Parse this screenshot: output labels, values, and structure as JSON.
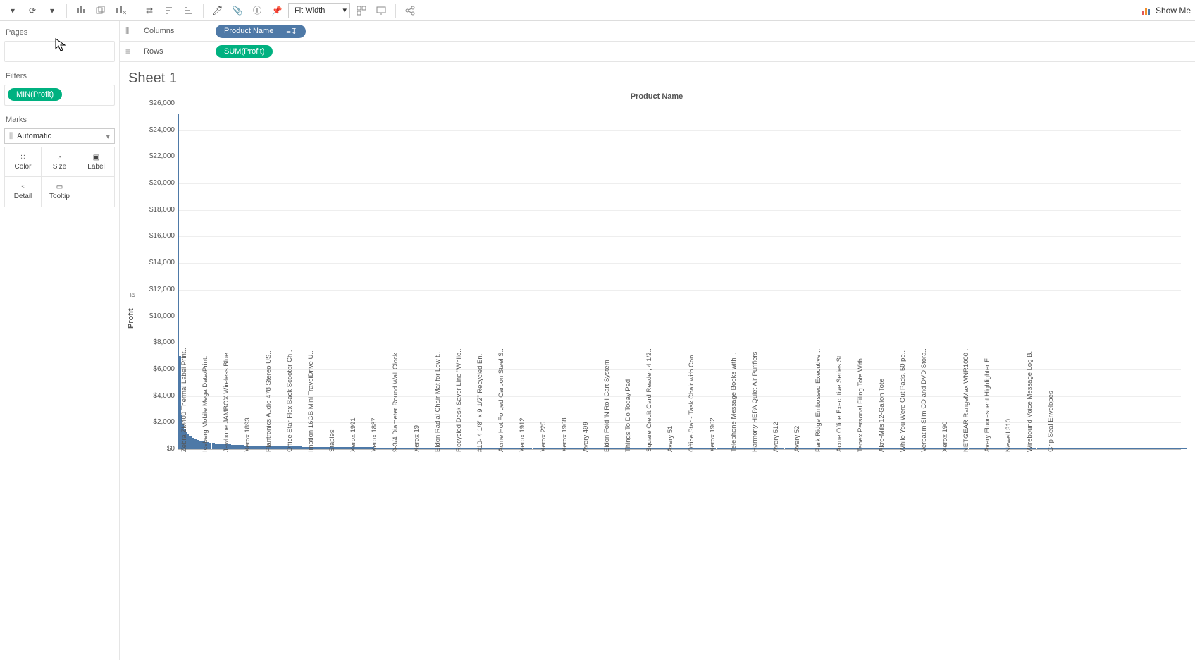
{
  "toolbar": {
    "fit_mode": "Fit Width",
    "showme": "Show Me"
  },
  "side": {
    "pages": "Pages",
    "filters": "Filters",
    "filter_pill": "MIN(Profit)",
    "marks": "Marks",
    "marks_type": "Automatic",
    "cells": {
      "color": "Color",
      "size": "Size",
      "label": "Label",
      "detail": "Detail",
      "tooltip": "Tooltip"
    }
  },
  "shelves": {
    "columns_label": "Columns",
    "rows_label": "Rows",
    "columns_pill": "Product Name",
    "rows_pill": "SUM(Profit)"
  },
  "sheet_title": "Sheet 1",
  "chart_data": {
    "type": "bar",
    "title": "Product Name",
    "ylabel": "Profit",
    "ylim": [
      0,
      26000
    ],
    "y_ticks": [
      "$0",
      "$2,000",
      "$4,000",
      "$6,000",
      "$8,000",
      "$10,000",
      "$12,000",
      "$14,000",
      "$16,000",
      "$18,000",
      "$20,000",
      "$22,000",
      "$24,000",
      "$26,000"
    ],
    "x_labels": [
      {
        "t": "Zebra ZM400 Thermal Label Print..",
        "p": 0
      },
      {
        "t": "Iceberg Mobile Mega Data/Print..",
        "p": 30
      },
      {
        "t": "Jawbone JAMBOX Wireless Blue..",
        "p": 60
      },
      {
        "t": "Xerox 1893",
        "p": 90
      },
      {
        "t": "Plantronics Audio 478 Stereo US..",
        "p": 120
      },
      {
        "t": "Office Star Flex Back Scooter Ch..",
        "p": 150
      },
      {
        "t": "Imation 16GB Mini TravelDrive U..",
        "p": 180
      },
      {
        "t": "Staples",
        "p": 210
      },
      {
        "t": "Xerox 1991",
        "p": 240
      },
      {
        "t": "Xerox 1887",
        "p": 270
      },
      {
        "t": "9-3/4 Diameter Round Wall Clock",
        "p": 300
      },
      {
        "t": "Xerox 19",
        "p": 330
      },
      {
        "t": "Eldon Radial Chair Mat for Low t..",
        "p": 360
      },
      {
        "t": "Recycled Desk Saver Line \"While..",
        "p": 390
      },
      {
        "t": "#10- 4 1/8\" x 9 1/2\" Recycled En..",
        "p": 420
      },
      {
        "t": "Acme Hot Forged Carbon Steel S..",
        "p": 450
      },
      {
        "t": "Xerox 1912",
        "p": 480
      },
      {
        "t": "Xerox 225",
        "p": 510
      },
      {
        "t": "Xerox 1968",
        "p": 540
      },
      {
        "t": "Avery 499",
        "p": 570
      },
      {
        "t": "Eldon Fold 'N Roll Cart System",
        "p": 600
      },
      {
        "t": "Things To Do Today Pad",
        "p": 630
      },
      {
        "t": "Square Credit Card Reader, 4 1/2..",
        "p": 660
      },
      {
        "t": "Avery 51",
        "p": 690
      },
      {
        "t": "Office Star - Task Chair with Con..",
        "p": 720
      },
      {
        "t": "Xerox 1962",
        "p": 750
      },
      {
        "t": "Telephone Message Books with ..",
        "p": 780
      },
      {
        "t": "Harmony HEPA Quiet Air Purifiers",
        "p": 810
      },
      {
        "t": "Avery 512",
        "p": 840
      },
      {
        "t": "Avery 52",
        "p": 870
      },
      {
        "t": "Park Ridge Embossed Executive ..",
        "p": 900
      },
      {
        "t": "Acme Office Executive Series St..",
        "p": 930
      },
      {
        "t": "Tenex Personal Filing Tote With ..",
        "p": 960
      },
      {
        "t": "Akro-Mils 12-Gallon Tote",
        "p": 990
      },
      {
        "t": "While You Were Out Pads, 50 pe..",
        "p": 1020
      },
      {
        "t": "Verbatim Slim CD and DVD Stora..",
        "p": 1050
      },
      {
        "t": "Xerox 190",
        "p": 1080
      },
      {
        "t": "NETGEAR RangeMax WNR1000 ..",
        "p": 1110
      },
      {
        "t": "Avery Fluorescent Highlighter F..",
        "p": 1140
      },
      {
        "t": "Newell 310",
        "p": 1170
      },
      {
        "t": "Wirebound Voice Message Log B..",
        "p": 1200
      },
      {
        "t": "Grip Seal Envelopes",
        "p": 1230
      }
    ],
    "bars_n": 620
  }
}
